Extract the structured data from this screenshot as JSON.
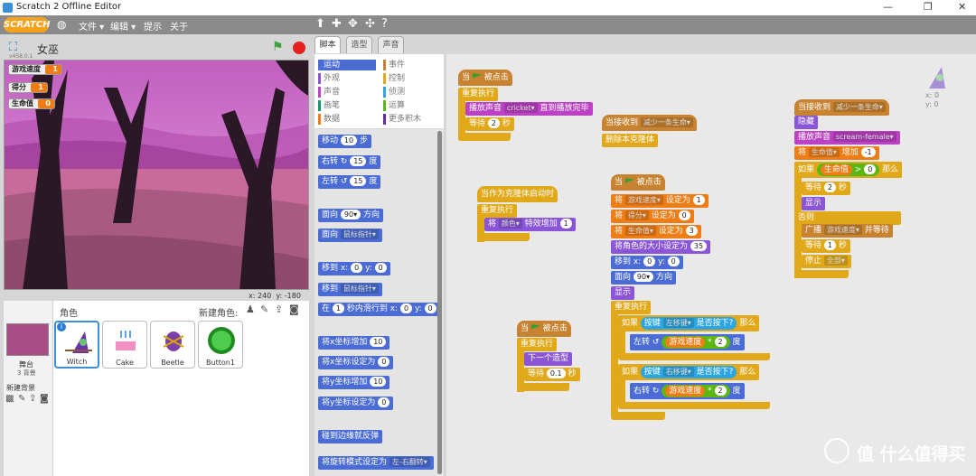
{
  "window": {
    "title": "Scratch 2 Offline Editor"
  },
  "menu": {
    "logo": "SCRATCH",
    "file": "文件 ▾",
    "edit": "编辑 ▾",
    "tips": "提示",
    "about": "关于"
  },
  "stage": {
    "project_name": "女巫",
    "version": "v458.0.1",
    "vars": [
      {
        "label": "游戏速度",
        "value": "1"
      },
      {
        "label": "得分",
        "value": "1"
      },
      {
        "label": "生命值",
        "value": "0"
      }
    ],
    "coords": {
      "x_label": "x:",
      "x": "240",
      "y_label": "y:",
      "y": "-180"
    }
  },
  "sprites": {
    "header": "角色",
    "new_sprite": "新建角色:",
    "items": [
      "Witch",
      "Cake",
      "Beetle",
      "Button1"
    ],
    "stage_label": "舞台",
    "backdrops": "3 背景",
    "new_backdrop": "新建背景"
  },
  "tabs": {
    "scripts": "脚本",
    "costumes": "造型",
    "sounds": "声音"
  },
  "categories": [
    {
      "label": "运动",
      "color": "#4a6cd4"
    },
    {
      "label": "事件",
      "color": "#c88330"
    },
    {
      "label": "外观",
      "color": "#8a55d7"
    },
    {
      "label": "控制",
      "color": "#e1a91a"
    },
    {
      "label": "声音",
      "color": "#bb42c3"
    },
    {
      "label": "侦测",
      "color": "#2ca5e2"
    },
    {
      "label": "画笔",
      "color": "#0e9a6c"
    },
    {
      "label": "运算",
      "color": "#5cb712"
    },
    {
      "label": "数据",
      "color": "#ee7d16"
    },
    {
      "label": "更多积木",
      "color": "#632d99"
    }
  ],
  "palette": {
    "move": "移动",
    "move_v": "10",
    "steps": "步",
    "turn_r": "右转",
    "turn_r_v": "15",
    "deg": "度",
    "turn_l": "左转",
    "turn_l_v": "15",
    "point_dir": "面向",
    "point_dir_v": "90▾",
    "dir": "方向",
    "point_to": "面向",
    "point_to_v": "鼠标指针▾",
    "goto_xy": "移到 x:",
    "goto_x": "0",
    "goto_y_lbl": "y:",
    "goto_y": "0",
    "goto": "移到",
    "goto_v": "鼠标指针▾",
    "glide": "在",
    "glide_v": "1",
    "glide_t": "秒内滑行到 x:",
    "glide_x": "0",
    "glide_yl": "y:",
    "glide_y": "0",
    "chx": "将x坐标增加",
    "chx_v": "10",
    "setx": "将x坐标设定为",
    "setx_v": "0",
    "chy": "将y坐标增加",
    "chy_v": "10",
    "sety": "将y坐标设定为",
    "sety_v": "0",
    "bounce": "碰到边缘就反弹",
    "rot": "将旋转模式设定为",
    "rot_v": "左-右翻转▾"
  },
  "scripts": {
    "s1": {
      "hat": "当",
      "hat2": "被点击",
      "forever": "重复执行",
      "play": "播放声音",
      "play_v": "cricket▾",
      "play2": "直到播放完毕",
      "wait": "等待",
      "wait_v": "2",
      "sec": "秒"
    },
    "s2": {
      "recv": "当接收到",
      "recv_v": "减少一条生命▾",
      "del": "删除本克隆体"
    },
    "s3": {
      "clone": "当作为克隆体启动时",
      "forever": "重复执行",
      "chg": "将",
      "chg_v": "颜色▾",
      "chg2": "特效增加",
      "chg_n": "1"
    },
    "s4": {
      "hat": "当",
      "hat2": "被点击",
      "forever": "重复执行",
      "next": "下一个造型",
      "wait": "等待",
      "wait_v": "0.1",
      "sec": "秒"
    },
    "s5": {
      "hat": "当",
      "hat2": "被点击",
      "set1": "将",
      "set1_v": "游戏速度▾",
      "set1_t": "设定为",
      "set1_n": "1",
      "set2": "将",
      "set2_v": "得分▾",
      "set2_t": "设定为",
      "set2_n": "0",
      "set3": "将",
      "set3_v": "生命值▾",
      "set3_t": "设定为",
      "set3_n": "3",
      "size": "将角色的大小设定为",
      "size_n": "35",
      "gotoxy": "移到 x:",
      "gx": "0",
      "gyl": "y:",
      "gy": "0",
      "face": "面向",
      "face_v": "90▾",
      "face_t": "方向",
      "show": "显示",
      "forever": "重复执行",
      "if1": "如果",
      "key": "按键",
      "key1": "左移键▾",
      "pressed": "是否按下?",
      "then": "那么",
      "turnl": "左转",
      "speed": "游戏速度",
      "mul": "*",
      "two": "2",
      "deg": "度",
      "if2": "如果",
      "key2": "右移键▾",
      "turnr": "右转"
    },
    "s6": {
      "recv": "当接收到",
      "recv_v": "减少一条生命▾",
      "hide": "隐藏",
      "play": "播放声音",
      "play_v": "scream-female▾",
      "chg": "将",
      "chg_v": "生命值▾",
      "chg_t": "增加",
      "chg_n": "-1",
      "if": "如果",
      "lives": "生命值",
      "gt": ">",
      "zero": "0",
      "then": "那么",
      "wait": "等待",
      "wait_v": "2",
      "sec": "秒",
      "show": "显示",
      "else": "否则",
      "bcast": "广播",
      "bcast_v": "游戏速度▾",
      "bcast_t": "并等待",
      "wait2": "等待",
      "wait2_v": "1",
      "sec2": "秒",
      "stop": "停止",
      "stop_v": "全部▾"
    },
    "sprite_info": {
      "x": "x: 0",
      "y": "y: 0"
    }
  },
  "watermark": "值 什么值得买",
  "colors": {
    "accent": "#4a6cd4",
    "menubar": "#8a8a8a"
  }
}
